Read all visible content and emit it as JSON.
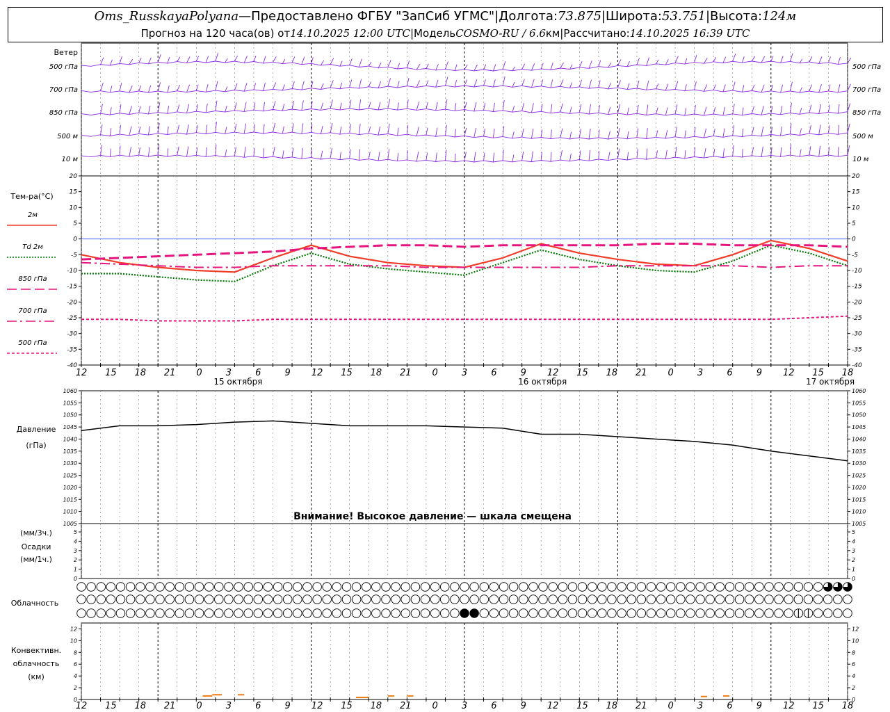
{
  "header": {
    "station": "Oms_RusskayaPolyana",
    "dash": " — ",
    "provider": "Предоставлено ФГБУ \"ЗапСиб УГМС\"",
    "sep": " | ",
    "lon_label": "Долгота: ",
    "lon": "73.875",
    "lat_label": "Широта: ",
    "lat": "53.751",
    "alt_label": "Высота: ",
    "alt": "124м",
    "forecast_label": "Прогноз на 120 часа(ов) от ",
    "forecast_from": "14.10.2025 12:00 UTC",
    "model_label": "Модель ",
    "model": "COSMO-RU / 6.6",
    "model_unit": "км",
    "calc_label": "Рассчитано: ",
    "calc_time": "14.10.2025 16:39 UTC"
  },
  "chart_data": [
    {
      "type": "wind-barbs",
      "panel_label": "Ветер",
      "levels": [
        "500 гПа",
        "700 гПа",
        "850 гПа",
        "500 м",
        "10 м"
      ]
    },
    {
      "type": "line",
      "panel_label": "Тем-ра(°C)",
      "ylim": [
        -40,
        20
      ],
      "yticks": [
        20,
        15,
        10,
        5,
        0,
        -5,
        -10,
        -15,
        -20,
        -25,
        -30,
        -35,
        -40
      ],
      "x_hours": [
        0,
        6,
        12,
        18,
        24,
        30,
        36,
        42,
        48,
        54,
        60,
        66,
        72,
        78,
        84,
        90,
        96,
        102,
        108,
        114,
        120
      ],
      "series": [
        {
          "name": "2м",
          "color": "#f03c28",
          "style": "solid",
          "values": [
            -5,
            -7.5,
            -9,
            -10,
            -10.5,
            -6,
            -2,
            -5.5,
            -7.5,
            -8.5,
            -9,
            -6,
            -1.5,
            -4.5,
            -6.5,
            -8,
            -8.5,
            -5,
            -0.5,
            -3,
            -7
          ]
        },
        {
          "name": "Td 2м",
          "color": "#007800",
          "style": "dotted",
          "values": [
            -11,
            -11,
            -12,
            -13,
            -13.5,
            -8.5,
            -4.5,
            -8,
            -9.5,
            -10.5,
            -11.5,
            -7.5,
            -3.5,
            -6.5,
            -8.5,
            -10,
            -10.5,
            -7,
            -2,
            -4.5,
            -8.5
          ]
        },
        {
          "name": "850 гПа",
          "color": "#e6147d",
          "style": "dashed",
          "values": [
            -6.5,
            -6,
            -5.5,
            -5,
            -4.5,
            -4,
            -3,
            -2.5,
            -2,
            -2,
            -2.5,
            -2,
            -2,
            -2,
            -2,
            -1.5,
            -1.5,
            -2,
            -2,
            -2,
            -2.5
          ]
        },
        {
          "name": "700 гПа",
          "color": "#e6147d",
          "style": "dashdot",
          "values": [
            -7.5,
            -8,
            -8.5,
            -9,
            -9,
            -8.5,
            -8.5,
            -8.5,
            -8.5,
            -9,
            -9,
            -9,
            -9,
            -9,
            -8.5,
            -8.5,
            -8.5,
            -8.5,
            -9,
            -8.5,
            -8.5
          ]
        },
        {
          "name": "500 гПа",
          "color": "#e6147d",
          "style": "finedash",
          "values": [
            -25.5,
            -25.5,
            -26,
            -26,
            -26,
            -25.5,
            -25.5,
            -25.5,
            -25.5,
            -25.5,
            -25.5,
            -25.5,
            -25.5,
            -25.5,
            -25.5,
            -25.5,
            -25.5,
            -25.5,
            -25.5,
            -25,
            -24.5
          ]
        }
      ]
    },
    {
      "type": "line",
      "panel_label_1": "Давление",
      "panel_label_2": "(гПа)",
      "ylim": [
        1005,
        1060
      ],
      "yticks": [
        1060,
        1055,
        1050,
        1045,
        1040,
        1035,
        1030,
        1025,
        1020,
        1015,
        1010,
        1005
      ],
      "x_hours": [
        0,
        6,
        12,
        18,
        24,
        30,
        36,
        42,
        48,
        54,
        60,
        66,
        72,
        78,
        84,
        90,
        96,
        102,
        108,
        114,
        120
      ],
      "series": [
        {
          "name": "Давление",
          "color": "#000000",
          "values": [
            1043.5,
            1045.5,
            1045.5,
            1046,
            1047,
            1047.5,
            1046.5,
            1045.5,
            1045.5,
            1045.5,
            1045,
            1044.5,
            1042,
            1042,
            1041,
            1040,
            1039,
            1037.5,
            1035,
            1033,
            1031
          ]
        }
      ],
      "annotation": "Внимание! Высокое давление — шкала смещена"
    },
    {
      "type": "bar",
      "panel_label_1": "(мм/3ч.)",
      "panel_label_2": "Осадки",
      "panel_label_3": "(мм/1ч.)",
      "ylim": [
        0,
        5
      ],
      "yticks": [
        5,
        4,
        3,
        2,
        1,
        0
      ],
      "values": []
    },
    {
      "type": "cloud-cover",
      "panel_label": "Облачность",
      "rows": 3,
      "columns": 79,
      "filled_cells": [
        {
          "row": 0,
          "col": 76,
          "cover": 0.75
        },
        {
          "row": 0,
          "col": 77,
          "cover": 0.75
        },
        {
          "row": 0,
          "col": 78,
          "cover": 0.75
        },
        {
          "row": 2,
          "col": 39,
          "cover": 1
        },
        {
          "row": 2,
          "col": 40,
          "cover": 1
        },
        {
          "row": 2,
          "col": 73,
          "cover": 0.25
        },
        {
          "row": 2,
          "col": 74,
          "cover": 0.25
        }
      ]
    },
    {
      "type": "bar",
      "panel_label_1": "Конвективн.",
      "panel_label_2": "облачность",
      "panel_label_3": "(км)",
      "ylim": [
        0,
        13
      ],
      "yticks": [
        12,
        10,
        8,
        6,
        4,
        2,
        0
      ],
      "color": "#f07d14",
      "segments": [
        {
          "x_from": 19,
          "x_to": 20.5,
          "base": 0.5,
          "top": 0.6
        },
        {
          "x_from": 20.5,
          "x_to": 22,
          "base": 0.7,
          "top": 0.8
        },
        {
          "x_from": 24.5,
          "x_to": 25.5,
          "base": 0.7,
          "top": 0.8
        },
        {
          "x_from": 43,
          "x_to": 45,
          "base": 0.3,
          "top": 0.35
        },
        {
          "x_from": 48,
          "x_to": 49,
          "base": 0.5,
          "top": 0.6
        },
        {
          "x_from": 51,
          "x_to": 52,
          "base": 0.5,
          "top": 0.6
        },
        {
          "x_from": 97,
          "x_to": 98,
          "base": 0.4,
          "top": 0.5
        },
        {
          "x_from": 100.5,
          "x_to": 101.5,
          "base": 0.5,
          "top": 0.6
        }
      ]
    }
  ],
  "time_axis": {
    "tick_labels": [
      "12",
      "15",
      "18",
      "21",
      "0",
      "3",
      "6",
      "9",
      "12",
      "15",
      "18",
      "21",
      "0",
      "3",
      "6",
      "9",
      "12",
      "15",
      "18",
      "21",
      "0",
      "3",
      "6",
      "9",
      "12",
      "15",
      "18"
    ],
    "date_labels": [
      {
        "text": "15 октября",
        "hour": 24
      },
      {
        "text": "16 октября",
        "hour": 72
      },
      {
        "text": "17 октября",
        "hour": 120
      }
    ]
  }
}
